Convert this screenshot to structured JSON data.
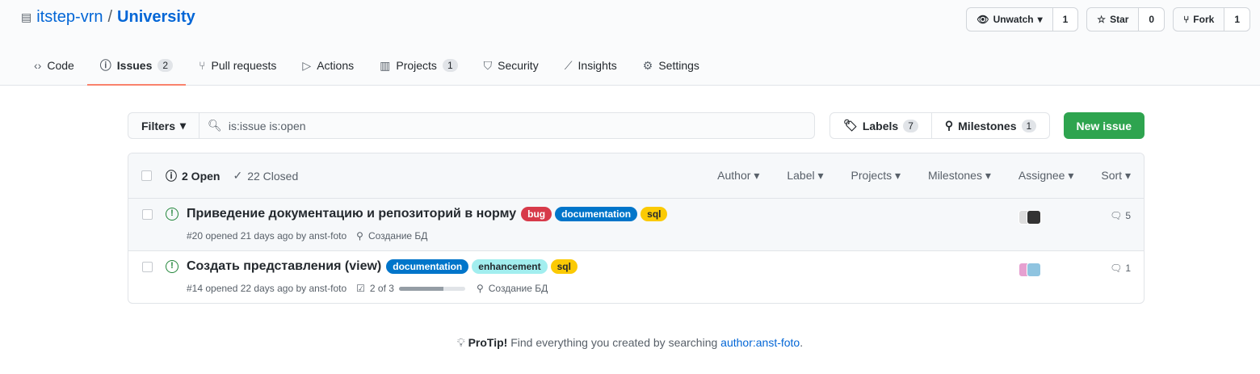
{
  "repo": {
    "owner": "itstep-vrn",
    "name": "University"
  },
  "actions": [
    {
      "label": "Unwatch",
      "count": "1",
      "icon": "eye-icon"
    },
    {
      "label": "Star",
      "count": "0",
      "icon": "star-icon"
    },
    {
      "label": "Fork",
      "count": "1",
      "icon": "fork-icon"
    }
  ],
  "tabs": [
    {
      "label": "Code",
      "icon": "‹›"
    },
    {
      "label": "Issues",
      "count": "2",
      "icon": "ⓘ"
    },
    {
      "label": "Pull requests",
      "icon": "⑂"
    },
    {
      "label": "Actions",
      "icon": "▷"
    },
    {
      "label": "Projects",
      "count": "1",
      "icon": "▥"
    },
    {
      "label": "Security",
      "icon": "⛉"
    },
    {
      "label": "Insights",
      "icon": "⟋"
    },
    {
      "label": "Settings",
      "icon": "⚙"
    }
  ],
  "filters": {
    "label": "Filters",
    "query": "is:issue is:open",
    "labels": "Labels",
    "labels_count": "7",
    "milestones": "Milestones",
    "milestones_count": "1",
    "new_issue": "New issue"
  },
  "list_header": {
    "open": "2 Open",
    "closed": "22 Closed",
    "filters": [
      "Author",
      "Label",
      "Projects",
      "Milestones",
      "Assignee",
      "Sort"
    ]
  },
  "issues": [
    {
      "title": "Приведение документацию и репозиторий в норму",
      "labels": [
        {
          "name": "bug",
          "bg": "#d73a4a",
          "fg": "#ffffff"
        },
        {
          "name": "documentation",
          "bg": "#0075ca",
          "fg": "#ffffff"
        },
        {
          "name": "sql",
          "bg": "#fbca04",
          "fg": "#24292e"
        }
      ],
      "meta": "#20 opened 21 days ago by anst-foto",
      "milestone": "Создание БД",
      "comments": "5"
    },
    {
      "title": "Создать представления (view)",
      "labels": [
        {
          "name": "documentation",
          "bg": "#0075ca",
          "fg": "#ffffff"
        },
        {
          "name": "enhancement",
          "bg": "#a2eeef",
          "fg": "#24292e"
        },
        {
          "name": "sql",
          "bg": "#fbca04",
          "fg": "#24292e"
        }
      ],
      "meta": "#14 opened 22 days ago by anst-foto",
      "tasks": "2 of 3",
      "task_progress": 0.67,
      "milestone": "Создание БД",
      "comments": "1"
    }
  ],
  "protip": {
    "bold": "ProTip!",
    "text": " Find everything you created by searching ",
    "link": "author:anst-foto",
    "end": "."
  }
}
